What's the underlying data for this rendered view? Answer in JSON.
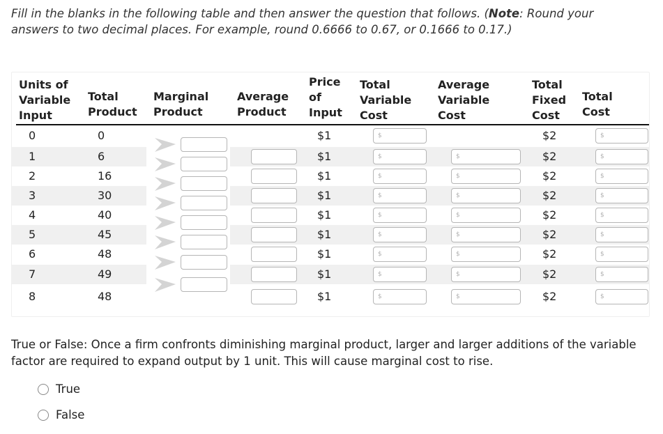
{
  "instructions": {
    "prefix": "Fill in the blanks in the following table and then answer the question that follows. (",
    "note_label": "Note",
    "suffix": ": Round your answers to two decimal places. For example, round 0.6666 to 0.67, or 0.1666 to 0.17.)"
  },
  "table": {
    "headers": {
      "units": [
        "Units of",
        "Variable",
        "Input"
      ],
      "total_product": [
        "Total",
        "Product"
      ],
      "marginal_product": [
        "Marginal",
        "Product"
      ],
      "average_product": [
        "Average",
        "Product"
      ],
      "price": [
        "Price",
        "of",
        "Input"
      ],
      "tvc": [
        "Total",
        "Variable",
        "Cost"
      ],
      "avc": [
        "Average",
        "Variable",
        "Cost"
      ],
      "tfc": [
        "Total",
        "Fixed",
        "Cost"
      ],
      "tc": [
        "Total",
        "Cost"
      ]
    },
    "currency_placeholder": "$",
    "rows": [
      {
        "units": "0",
        "total_product": "0",
        "price": "$1",
        "tfc": "$2"
      },
      {
        "units": "1",
        "total_product": "6",
        "price": "$1",
        "tfc": "$2"
      },
      {
        "units": "2",
        "total_product": "16",
        "price": "$1",
        "tfc": "$2"
      },
      {
        "units": "3",
        "total_product": "30",
        "price": "$1",
        "tfc": "$2"
      },
      {
        "units": "4",
        "total_product": "40",
        "price": "$1",
        "tfc": "$2"
      },
      {
        "units": "5",
        "total_product": "45",
        "price": "$1",
        "tfc": "$2"
      },
      {
        "units": "6",
        "total_product": "48",
        "price": "$1",
        "tfc": "$2"
      },
      {
        "units": "7",
        "total_product": "49",
        "price": "$1",
        "tfc": "$2"
      },
      {
        "units": "8",
        "total_product": "48",
        "price": "$1",
        "tfc": "$2"
      }
    ],
    "marginal_product_values": [
      "",
      "",
      "",
      "",
      "",
      "",
      "",
      ""
    ],
    "average_product_values": [
      "",
      "",
      "",
      "",
      "",
      "",
      "",
      ""
    ],
    "tvc_values": [
      "",
      "",
      "",
      "",
      "",
      "",
      "",
      "",
      ""
    ],
    "avc_values": [
      "",
      "",
      "",
      "",
      "",
      "",
      "",
      ""
    ],
    "tc_values": [
      "",
      "",
      "",
      "",
      "",
      "",
      "",
      "",
      ""
    ]
  },
  "question": {
    "text": "True or False: Once a firm confronts diminishing marginal product, larger and larger additions of the variable factor are required to expand output by 1 unit. This will cause marginal cost to rise.",
    "options": [
      {
        "label": "True",
        "selected": false
      },
      {
        "label": "False",
        "selected": false
      }
    ]
  },
  "colors": {
    "row_shade": "#f0f0f0",
    "input_border": "#b5b5b5",
    "chevron": "#d4d4d4"
  }
}
